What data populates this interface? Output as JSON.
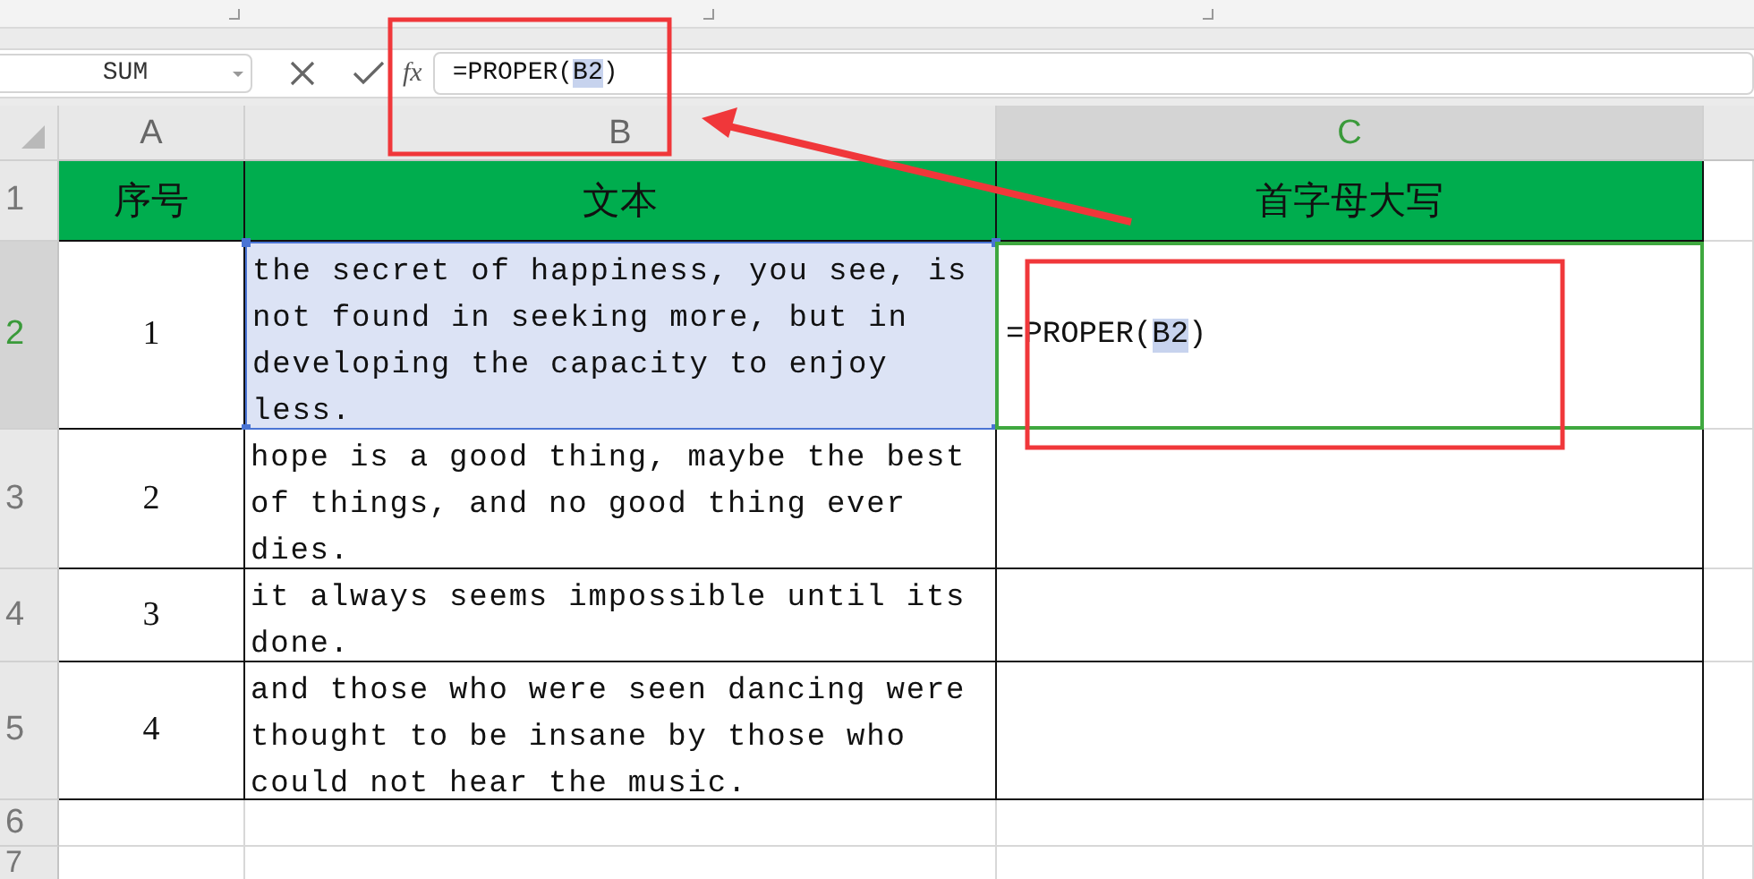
{
  "name_box": {
    "value": "SUM"
  },
  "formula_bar": {
    "function_label": "fx",
    "formula": [
      {
        "kind": "text",
        "text": "=PROPER("
      },
      {
        "kind": "ref",
        "text": "B2"
      },
      {
        "kind": "text",
        "text": ")"
      }
    ]
  },
  "columns": [
    {
      "label": "A",
      "selected": false
    },
    {
      "label": "B",
      "selected": false
    },
    {
      "label": "C",
      "selected": true
    }
  ],
  "rows": [
    {
      "number": "1",
      "selected": false,
      "kind": "header",
      "cells": [
        {
          "text": "序号",
          "selected": false,
          "referenced": false
        },
        {
          "text": "文本",
          "selected": false,
          "referenced": false
        },
        {
          "text": "首字母大写",
          "selected": false,
          "referenced": false
        }
      ]
    },
    {
      "number": "2",
      "selected": true,
      "kind": "data",
      "cells": [
        {
          "text": "1",
          "selected": false,
          "referenced": false
        },
        {
          "text": "the secret of happiness, you see, is not found in seeking more, but in developing the capacity to enjoy less.",
          "selected": false,
          "referenced": true
        },
        {
          "formula": [
            {
              "kind": "text",
              "text": "=PROPER("
            },
            {
              "kind": "ref",
              "text": "B2"
            },
            {
              "kind": "text",
              "text": ")"
            }
          ],
          "selected": true,
          "referenced": false
        }
      ]
    },
    {
      "number": "3",
      "selected": false,
      "kind": "data",
      "cells": [
        {
          "text": "2",
          "selected": false,
          "referenced": false
        },
        {
          "text": "hope is a good thing, maybe the best of things, and no good thing ever dies.",
          "selected": false,
          "referenced": false
        },
        {
          "selected": false,
          "referenced": false
        }
      ]
    },
    {
      "number": "4",
      "selected": false,
      "kind": "data",
      "cells": [
        {
          "text": "3",
          "selected": false,
          "referenced": false
        },
        {
          "text": "it always seems impossible until its done.",
          "selected": false,
          "referenced": false
        },
        {
          "selected": false,
          "referenced": false
        }
      ]
    },
    {
      "number": "5",
      "selected": false,
      "kind": "data",
      "cells": [
        {
          "text": "4",
          "selected": false,
          "referenced": false
        },
        {
          "text": "and those who were seen dancing were thought to be insane by those who could not hear the music.",
          "selected": false,
          "referenced": false
        },
        {
          "selected": false,
          "referenced": false
        }
      ]
    },
    {
      "number": "6",
      "selected": false,
      "kind": "empty"
    },
    {
      "number": "7",
      "selected": false,
      "kind": "empty"
    }
  ]
}
